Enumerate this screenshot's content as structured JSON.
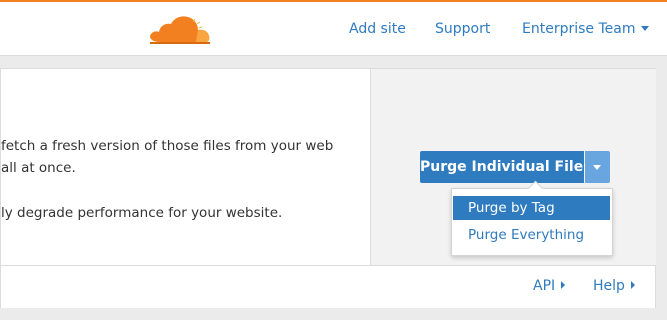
{
  "header": {
    "logo": "cloudflare-logo",
    "nav": [
      {
        "label": "Add site"
      },
      {
        "label": "Support"
      },
      {
        "label": "Enterprise Team"
      }
    ]
  },
  "purge": {
    "description_lines": [
      "fetch a fresh version of those files from your web",
      "all at once.",
      "ly degrade performance for your website."
    ],
    "button_label": "Purge Individual Files",
    "dropdown": [
      {
        "label": "Purge by Tag",
        "selected": true
      },
      {
        "label": "Purge Everything",
        "selected": false
      }
    ]
  },
  "footer": {
    "links": [
      {
        "label": "API"
      },
      {
        "label": "Help"
      }
    ]
  },
  "colors": {
    "accent": "#2f7bbf",
    "brand_orange": "#f38020"
  }
}
